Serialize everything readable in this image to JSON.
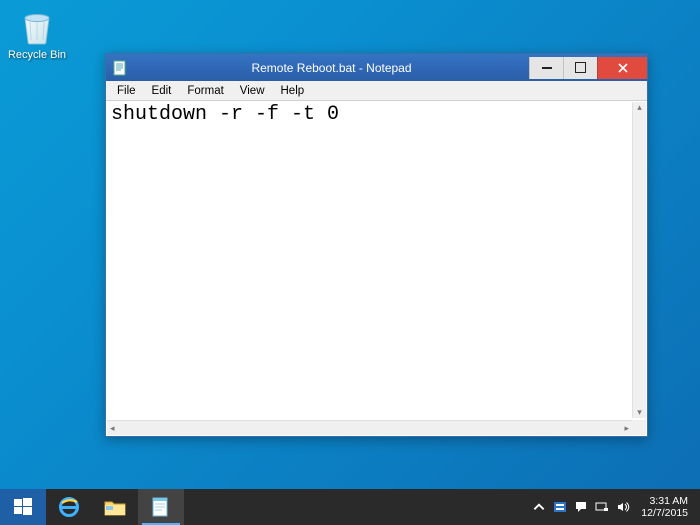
{
  "desktop": {
    "recycle_bin_label": "Recycle Bin"
  },
  "window": {
    "title": "Remote Reboot.bat - Notepad",
    "menus": {
      "file": "File",
      "edit": "Edit",
      "format": "Format",
      "view": "View",
      "help": "Help"
    },
    "content": "shutdown -r -f -t 0"
  },
  "taskbar": {
    "clock_time": "3:31 AM",
    "clock_date": "12/7/2015"
  }
}
